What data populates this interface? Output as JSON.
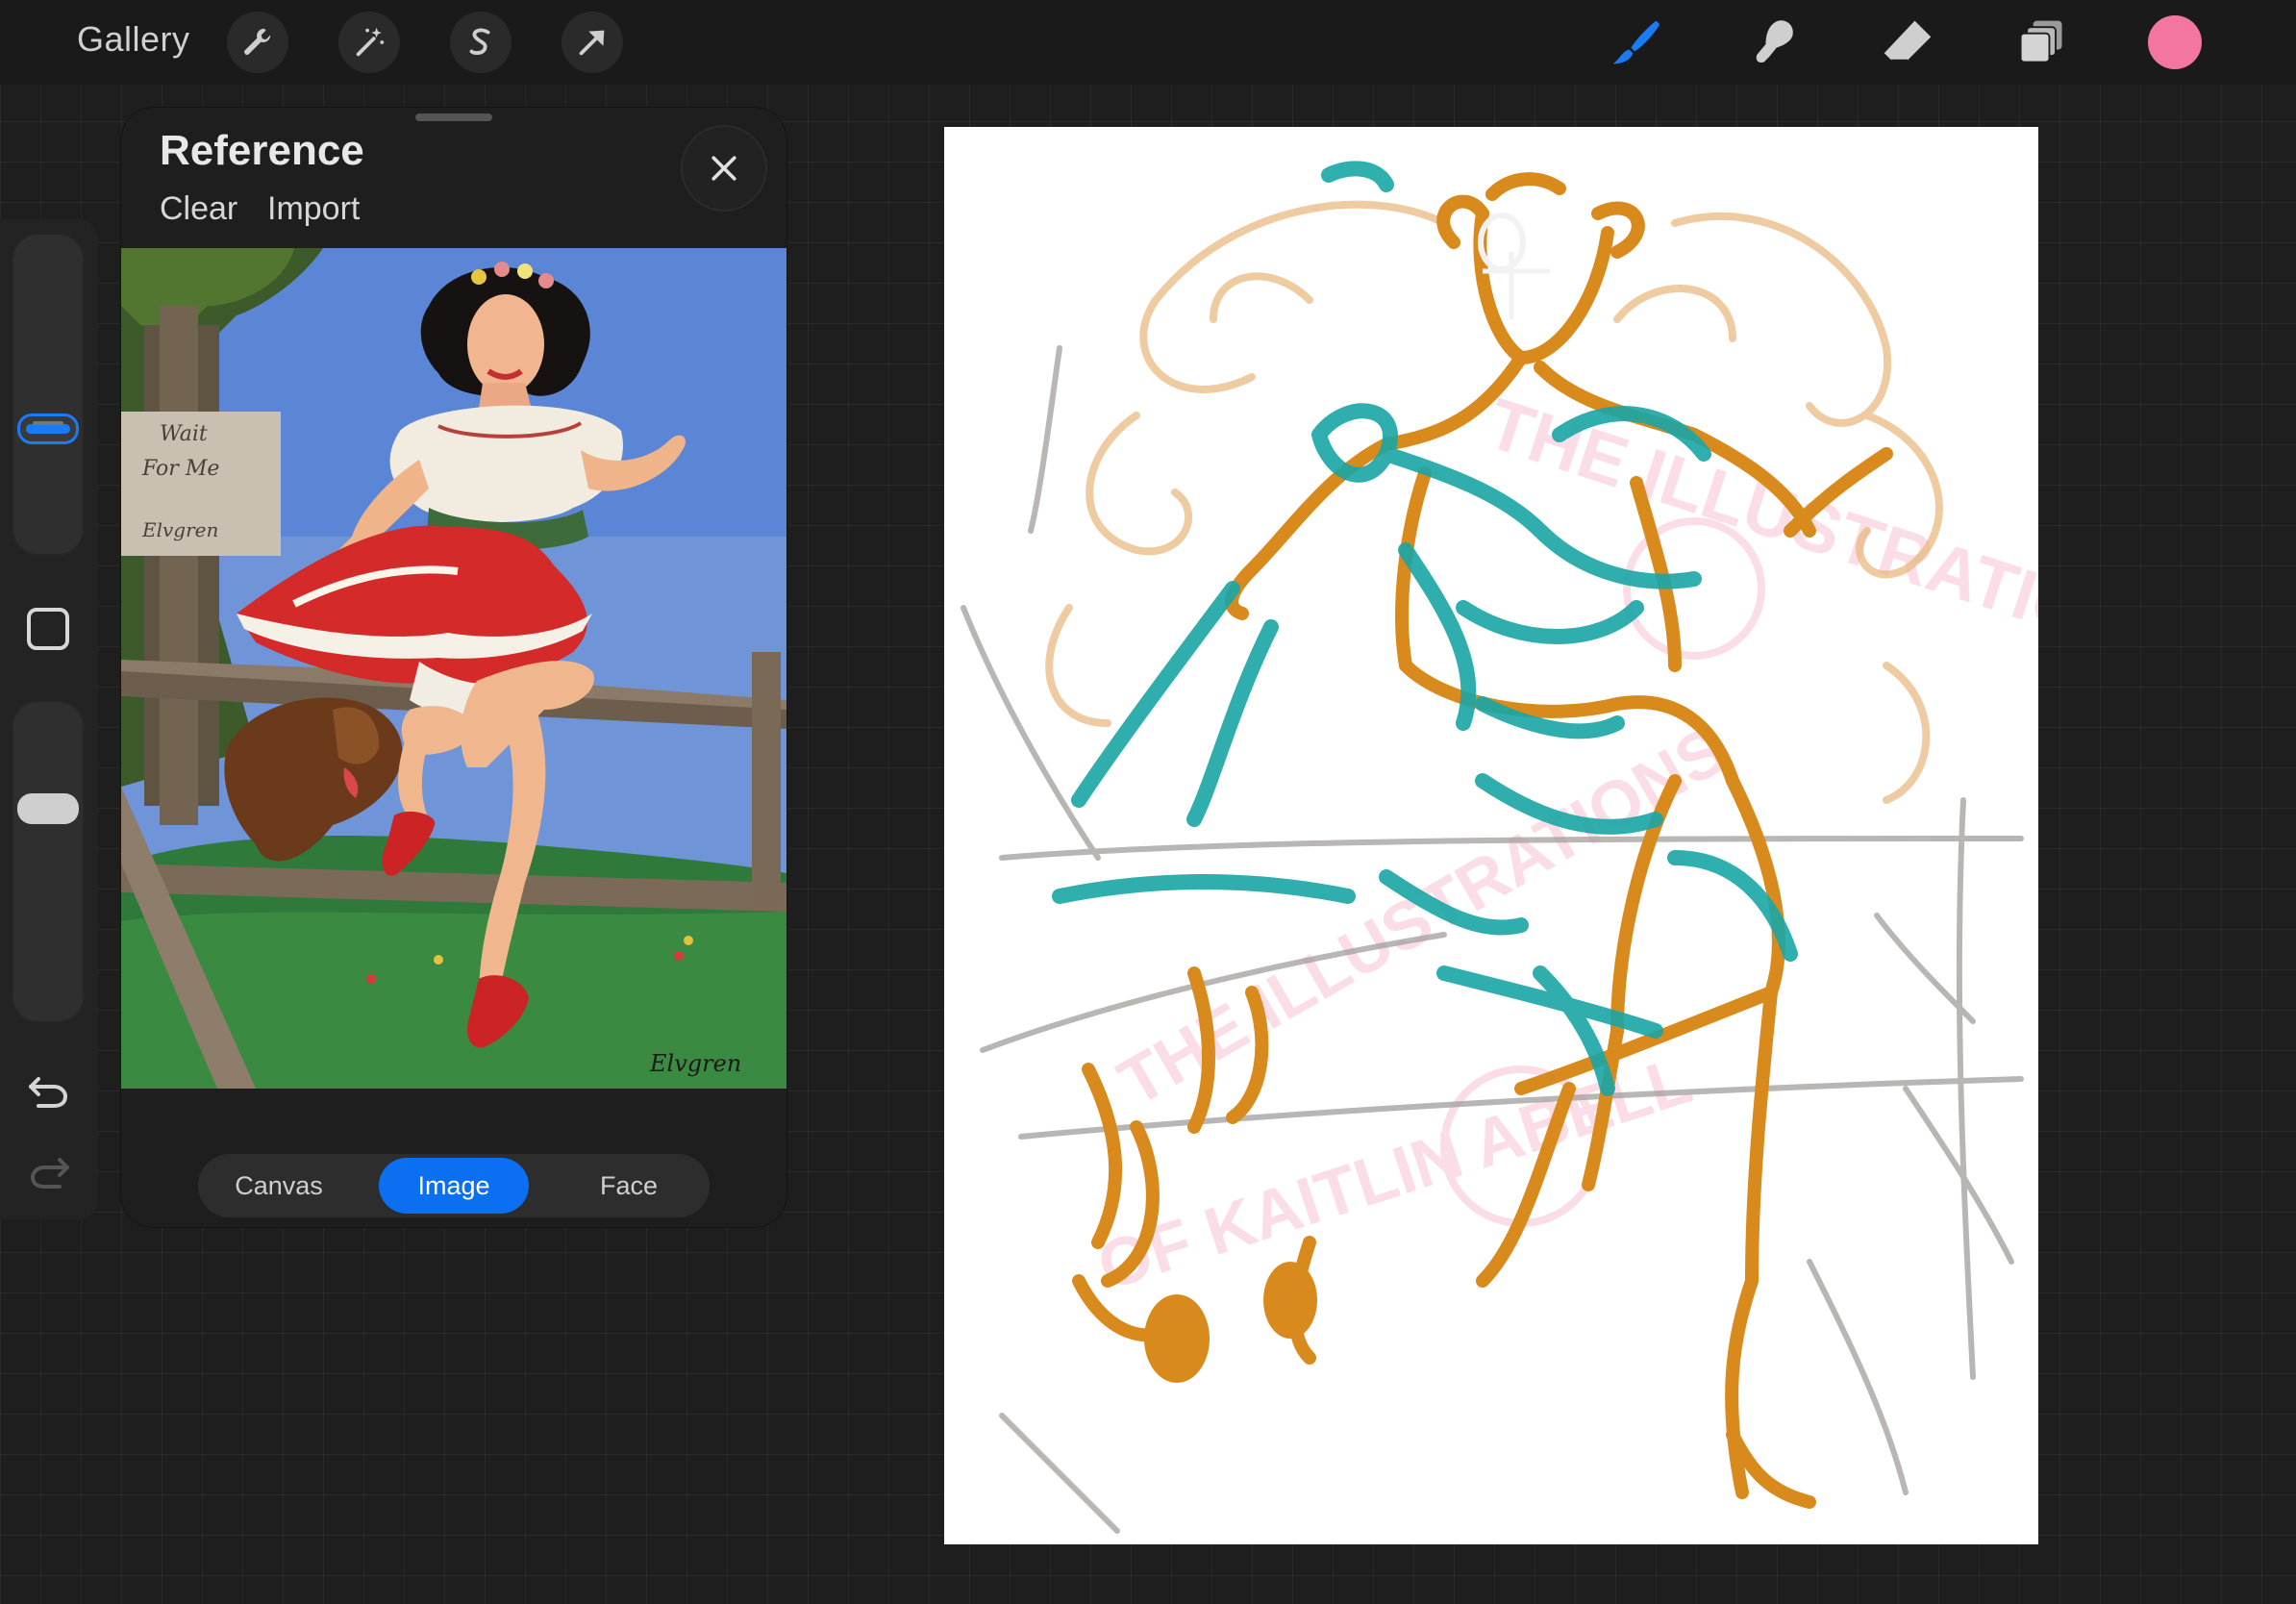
{
  "topbar": {
    "gallery_label": "Gallery",
    "left_tools": [
      "wrench-icon",
      "magic-wand-icon",
      "selection-s-icon",
      "transform-arrow-icon"
    ],
    "right_tools": [
      "brush-icon",
      "smudge-icon",
      "eraser-icon",
      "layers-icon"
    ],
    "active_tool": "brush-icon",
    "current_color": "#f2769f"
  },
  "sidebar": {
    "brush_size_level": 0.38,
    "opacity_level": 0.68
  },
  "reference_panel": {
    "title": "Reference",
    "clear_label": "Clear",
    "import_label": "Import",
    "image_sign_lines": [
      "Wait",
      "For Me",
      "Elvgren"
    ],
    "image_signature": "Elvgren",
    "tabs": [
      {
        "label": "Canvas",
        "active": false
      },
      {
        "label": "Image",
        "active": true
      },
      {
        "label": "Face",
        "active": false
      }
    ]
  },
  "canvas": {
    "watermark_top": "THE ILLUSTRATIONS",
    "watermark_bottom": "OF KAITLIN ABELL",
    "stroke_colors": {
      "orange": "#d98a1c",
      "teal": "#1aa6a6",
      "gray": "#9c9a98",
      "watermark": "#f6c2d4"
    }
  }
}
